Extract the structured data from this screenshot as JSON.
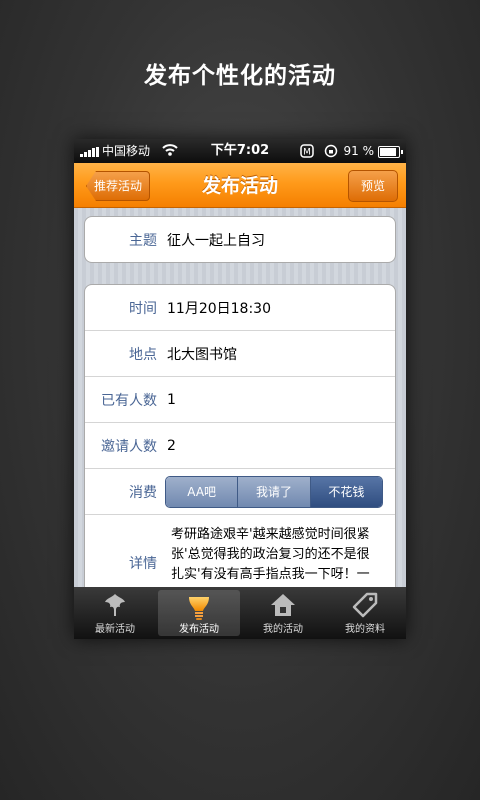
{
  "promo_title": "发布个性化的活动",
  "statusbar": {
    "carrier": "中国移动",
    "time": "下午7:02",
    "battery": "91 %"
  },
  "navbar": {
    "back_label": "推荐活动",
    "title": "发布活动",
    "preview_label": "预览"
  },
  "form": {
    "topic": {
      "label": "主题",
      "value": "征人一起上自习"
    },
    "time": {
      "label": "时间",
      "value": "11月20日18:30"
    },
    "place": {
      "label": "地点",
      "value": "北大图书馆"
    },
    "joined": {
      "label": "已有人数",
      "value": "1"
    },
    "invite": {
      "label": "邀请人数",
      "value": "2"
    },
    "cost": {
      "label": "消费",
      "options": [
        "AA吧",
        "我请了",
        "不花钱"
      ],
      "selected": "不花钱"
    },
    "detail": {
      "label": "详情",
      "value": "考研路途艰辛'越来越感觉时间很紧张'总觉得我的政治复习的还不是很扎实'有没有高手指点我一下呀！一起上自习"
    }
  },
  "tabs": [
    {
      "label": "最新活动",
      "icon": "leaf-icon"
    },
    {
      "label": "发布活动",
      "icon": "bulb-icon",
      "active": true
    },
    {
      "label": "我的活动",
      "icon": "home-icon"
    },
    {
      "label": "我的资料",
      "icon": "tag-icon"
    }
  ],
  "colors": {
    "accent": "#ff9a1a",
    "label_blue": "#4a6695",
    "segment_selected": "#2f4d80"
  }
}
